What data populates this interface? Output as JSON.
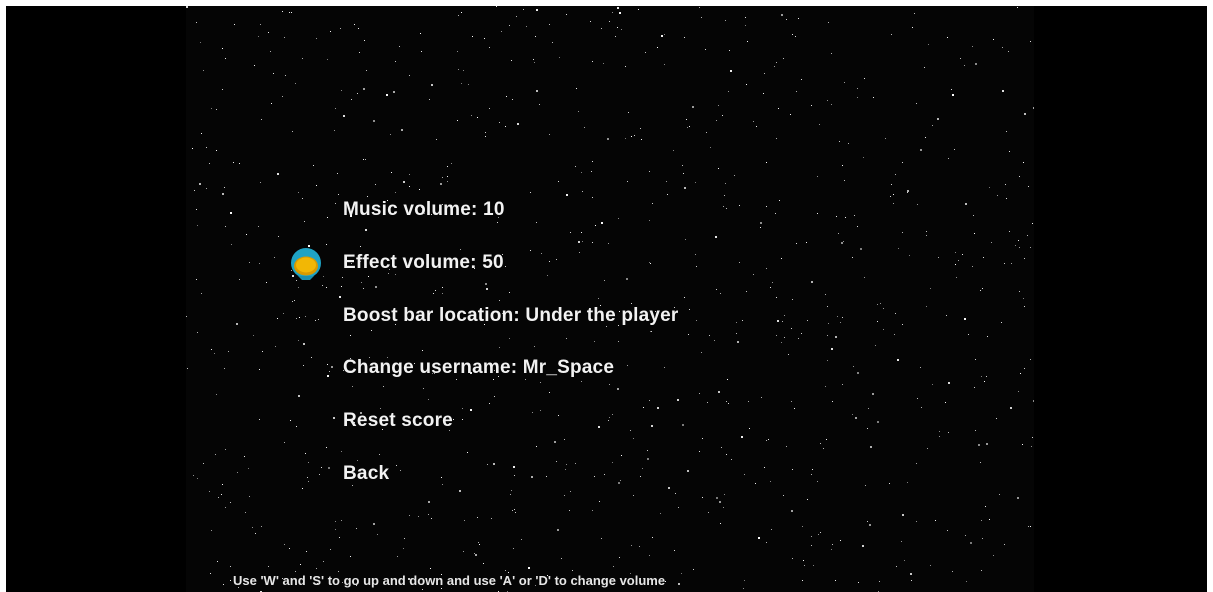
{
  "menu": {
    "items": [
      {
        "label": "Music volume: 10"
      },
      {
        "label": "Effect volume: 50"
      },
      {
        "label": "Boost bar location: Under the player"
      },
      {
        "label": "Change username: Mr_Space"
      },
      {
        "label": "Reset score"
      },
      {
        "label": "Back"
      }
    ],
    "selected_index": 1
  },
  "selector": {
    "icon": "astronaut-helmet-icon"
  },
  "help": {
    "text": "Use 'W' and 'S' to go up and down and use 'A' or 'D' to change volume"
  },
  "colors": {
    "background": "#000000",
    "text": "#f2f2f2",
    "helmet_shell": "#1fa3c4",
    "helmet_visor": "#f2b705"
  }
}
